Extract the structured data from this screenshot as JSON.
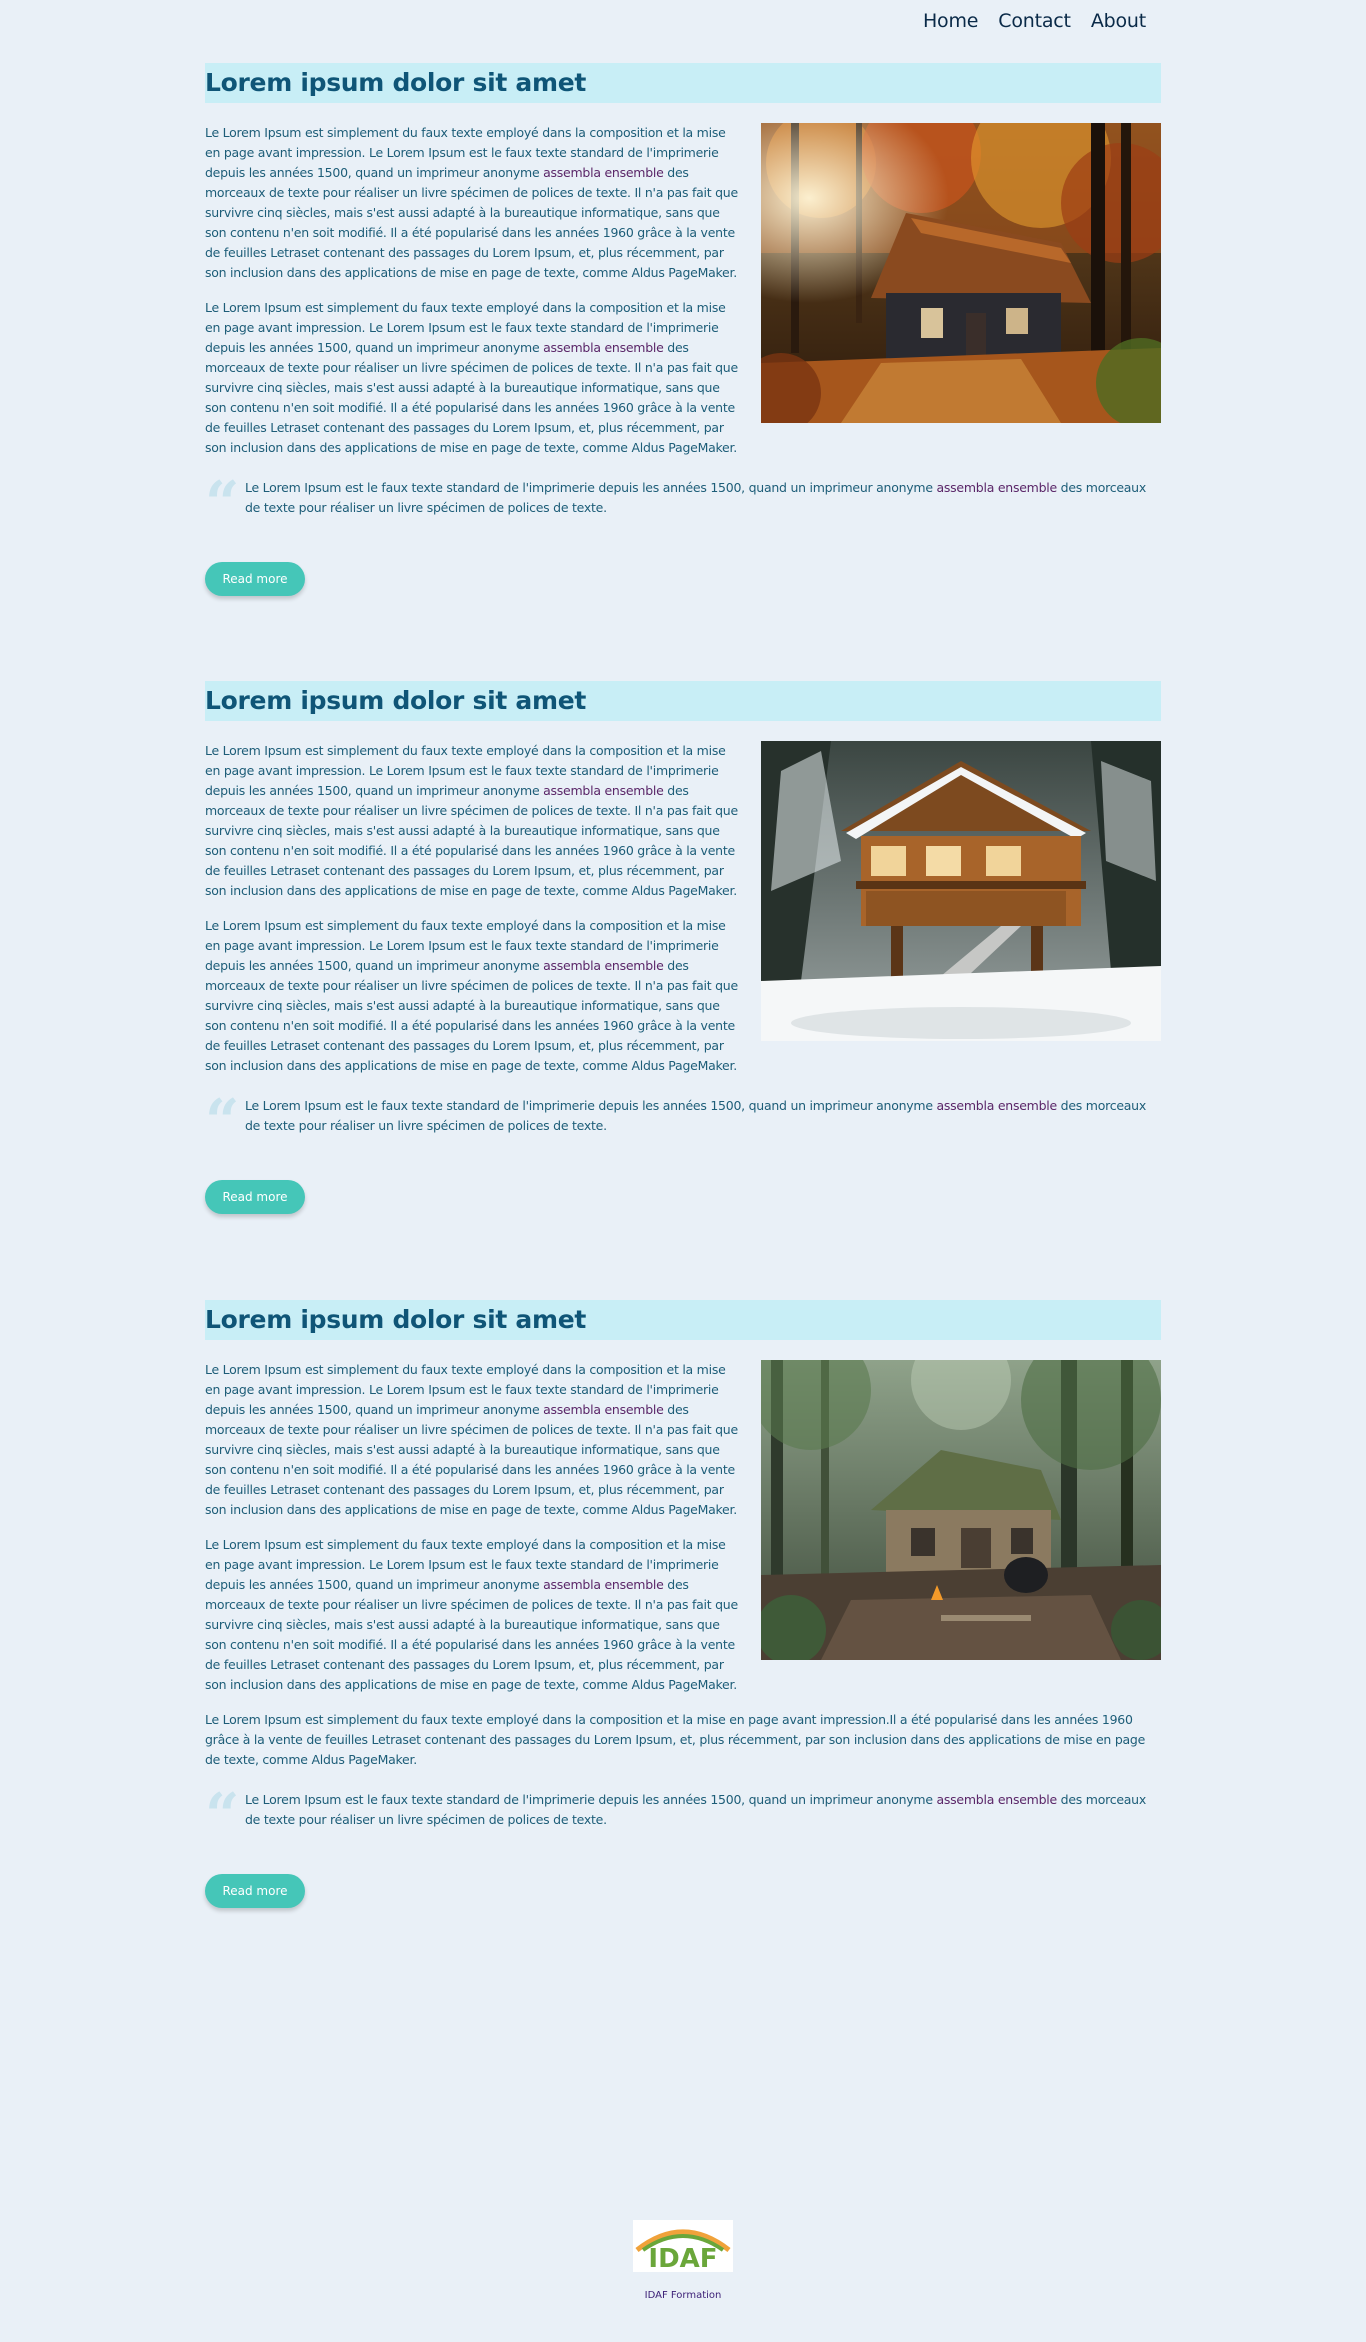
{
  "nav": {
    "items": [
      "Home",
      "Contact",
      "About"
    ]
  },
  "articles": [
    {
      "title": "Lorem ipsum dolor sit amet",
      "para1": {
        "pre": "Le Lorem Ipsum est simplement du faux texte employé dans la composition et la mise en page avant impression. Le Lorem Ipsum est le faux texte standard de l'imprimerie depuis les années 1500, quand un imprimeur anonyme ",
        "hl": "assembla ensemble",
        "post": " des morceaux de texte pour réaliser un livre spécimen de polices de texte. Il n'a pas fait que survivre cinq siècles, mais s'est aussi adapté à la bureautique informatique, sans que son contenu n'en soit modifié. Il a été popularisé dans les années 1960 grâce à la vente de feuilles Letraset contenant des passages du Lorem Ipsum, et, plus récemment, par son inclusion dans des applications de mise en page de texte, comme Aldus PageMaker."
      },
      "para2": {
        "pre": "Le Lorem Ipsum est simplement du faux texte employé dans la composition et la mise en page avant impression. Le Lorem Ipsum est le faux texte standard de l'imprimerie depuis les années 1500, quand un imprimeur anonyme ",
        "hl": "assembla ensemble",
        "post": " des morceaux de texte pour réaliser un livre spécimen de polices de texte. Il n'a pas fait que survivre cinq siècles, mais s'est aussi adapté à la bureautique informatique, sans que son contenu n'en soit modifié. Il a été popularisé dans les années 1960 grâce à la vente de feuilles Letraset contenant des passages du Lorem Ipsum, et, plus récemment, par son inclusion dans des applications de mise en page de texte, comme Aldus PageMaker."
      },
      "quote": {
        "pre": "Le Lorem Ipsum est le faux texte standard de l'imprimerie depuis les années 1500, quand un imprimeur anonyme ",
        "hl": "assembla ensemble",
        "post": " des morceaux de texte pour réaliser un livre spécimen de polices de texte."
      },
      "button": "Read more"
    },
    {
      "title": "Lorem ipsum dolor sit amet",
      "para1": {
        "pre": "Le Lorem Ipsum est simplement du faux texte employé dans la composition et la mise en page avant impression. Le Lorem Ipsum est le faux texte standard de l'imprimerie depuis les années 1500, quand un imprimeur anonyme ",
        "hl": "assembla ensemble",
        "post": " des morceaux de texte pour réaliser un livre spécimen de polices de texte. Il n'a pas fait que survivre cinq siècles, mais s'est aussi adapté à la bureautique informatique, sans que son contenu n'en soit modifié. Il a été popularisé dans les années 1960 grâce à la vente de feuilles Letraset contenant des passages du Lorem Ipsum, et, plus récemment, par son inclusion dans des applications de mise en page de texte, comme Aldus PageMaker."
      },
      "para2": {
        "pre": "Le Lorem Ipsum est simplement du faux texte employé dans la composition et la mise en page avant impression. Le Lorem Ipsum est le faux texte standard de l'imprimerie depuis les années 1500, quand un imprimeur anonyme ",
        "hl": "assembla ensemble",
        "post": " des morceaux de texte pour réaliser un livre spécimen de polices de texte. Il n'a pas fait que survivre cinq siècles, mais s'est aussi adapté à la bureautique informatique, sans que son contenu n'en soit modifié. Il a été popularisé dans les années 1960 grâce à la vente de feuilles Letraset contenant des passages du Lorem Ipsum, et, plus récemment, par son inclusion dans des applications de mise en page de texte, comme Aldus PageMaker."
      },
      "quote": {
        "pre": "Le Lorem Ipsum est le faux texte standard de l'imprimerie depuis les années 1500, quand un imprimeur anonyme ",
        "hl": "assembla ensemble",
        "post": " des morceaux de texte pour réaliser un livre spécimen de polices de texte."
      },
      "button": "Read more"
    },
    {
      "title": "Lorem ipsum dolor sit amet",
      "para1": {
        "pre": "Le Lorem Ipsum est simplement du faux texte employé dans la composition et la mise en page avant impression. Le Lorem Ipsum est le faux texte standard de l'imprimerie depuis les années 1500, quand un imprimeur anonyme ",
        "hl": "assembla ensemble",
        "post": " des morceaux de texte pour réaliser un livre spécimen de polices de texte. Il n'a pas fait que survivre cinq siècles, mais s'est aussi adapté à la bureautique informatique, sans que son contenu n'en soit modifié. Il a été popularisé dans les années 1960 grâce à la vente de feuilles Letraset contenant des passages du Lorem Ipsum, et, plus récemment, par son inclusion dans des applications de mise en page de texte, comme Aldus PageMaker."
      },
      "para2": {
        "pre": "Le Lorem Ipsum est simplement du faux texte employé dans la composition et la mise en page avant impression. Le Lorem Ipsum est le faux texte standard de l'imprimerie depuis les années 1500, quand un imprimeur anonyme ",
        "hl": "assembla ensemble",
        "post": " des morceaux de texte pour réaliser un livre spécimen de polices de texte. Il n'a pas fait que survivre cinq siècles, mais s'est aussi adapté à la bureautique informatique, sans que son contenu n'en soit modifié. Il a été popularisé dans les années 1960 grâce à la vente de feuilles Letraset contenant des passages du Lorem Ipsum, et, plus récemment, par son inclusion dans des applications de mise en page de texte, comme Aldus PageMaker."
      },
      "para3": "Le Lorem Ipsum est simplement du faux texte employé dans la composition et la mise en page avant impression.Il a été popularisé dans les années 1960 grâce à la vente de feuilles Letraset contenant des passages du Lorem Ipsum, et, plus récemment, par son inclusion dans des applications de mise en page de texte, comme Aldus PageMaker.",
      "quote": {
        "pre": "Le Lorem Ipsum est le faux texte standard de l'imprimerie depuis les années 1500, quand un imprimeur anonyme ",
        "hl": "assembla ensemble",
        "post": " des morceaux de texte pour réaliser un livre spécimen de polices de texte."
      },
      "button": "Read more"
    }
  ],
  "footer": {
    "logo_text": "IDAF",
    "caption": "IDAF Formation"
  },
  "colors": {
    "background": "#e9f0f7",
    "title_band": "#c8eef6",
    "title_text": "#0f5577",
    "body_text": "#1d5d78",
    "highlight": "#5a2668",
    "button": "#45c6b8"
  }
}
